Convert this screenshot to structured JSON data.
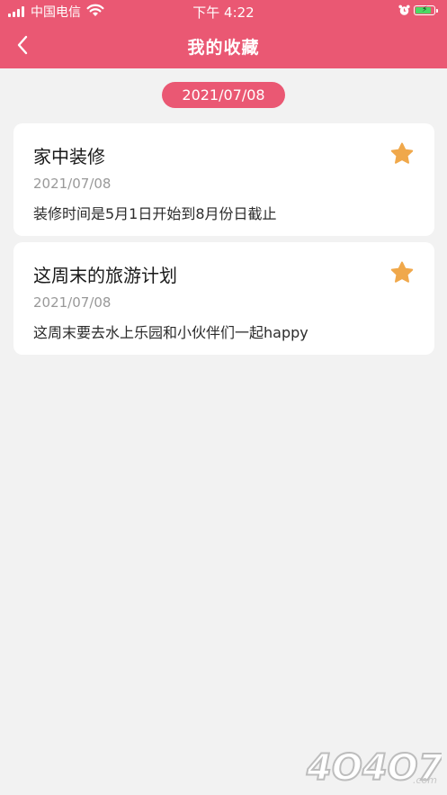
{
  "status_bar": {
    "carrier": "中国电信",
    "time": "下午 4:22",
    "battery_charging": true
  },
  "header": {
    "title": "我的收藏"
  },
  "section": {
    "date": "2021/07/08"
  },
  "favorites": [
    {
      "title": "家中装修",
      "date": "2021/07/08",
      "description": "装修时间是5月1日开始到8月份日截止",
      "starred": true
    },
    {
      "title": "这周末的旅游计划",
      "date": "2021/07/08",
      "description": "这周末要去水上乐园和小伙伴们一起happy",
      "starred": true
    }
  ],
  "watermark": {
    "text": "4O4O7",
    "suffix": ".com"
  },
  "colors": {
    "brand": "#ea5873",
    "star": "#f0a84b",
    "background": "#f2f2f2",
    "card": "#ffffff"
  }
}
